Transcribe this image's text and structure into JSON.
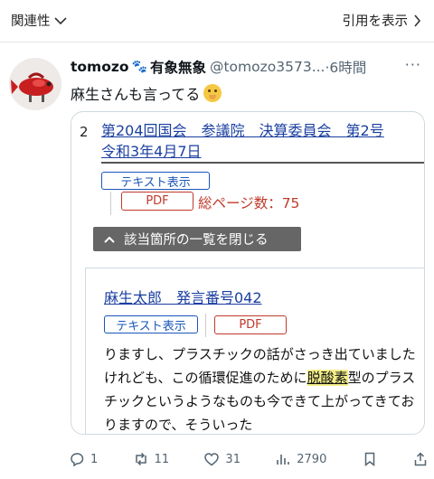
{
  "topbar": {
    "relevance_label": "関連性",
    "quote_link_label": "引用を表示"
  },
  "tweet": {
    "display_name": "tomozo",
    "name_emoji": "🐾",
    "name_suffix": "有象無象",
    "handle": "@tomozo3573...",
    "time": "·6時間",
    "text": "麻生さんも言ってる"
  },
  "card": {
    "item_number": "2",
    "title_line1": "第204回国会　参議院　決算委員会　第2号",
    "title_line2": "令和3年4月7日",
    "text_button": "テキスト表示",
    "pdf_button": "PDF",
    "page_count": "総ページ数：75",
    "collapse_button": "該当箇所の一覧を閉じる",
    "speech": {
      "speaker": "麻生太郎　発言番号042",
      "text_button": "テキスト表示",
      "pdf_button": "PDF",
      "text_before": "りますし、プラスチックの話がさっき出ていましたけれども、この循環促進のために",
      "highlight": "脱酸素",
      "text_after": "型のプラスチックというようなものも今できて上がってきておりますので、そういった"
    }
  },
  "actions": {
    "replies": "1",
    "retweets": "11",
    "likes": "31",
    "views": "2790"
  }
}
